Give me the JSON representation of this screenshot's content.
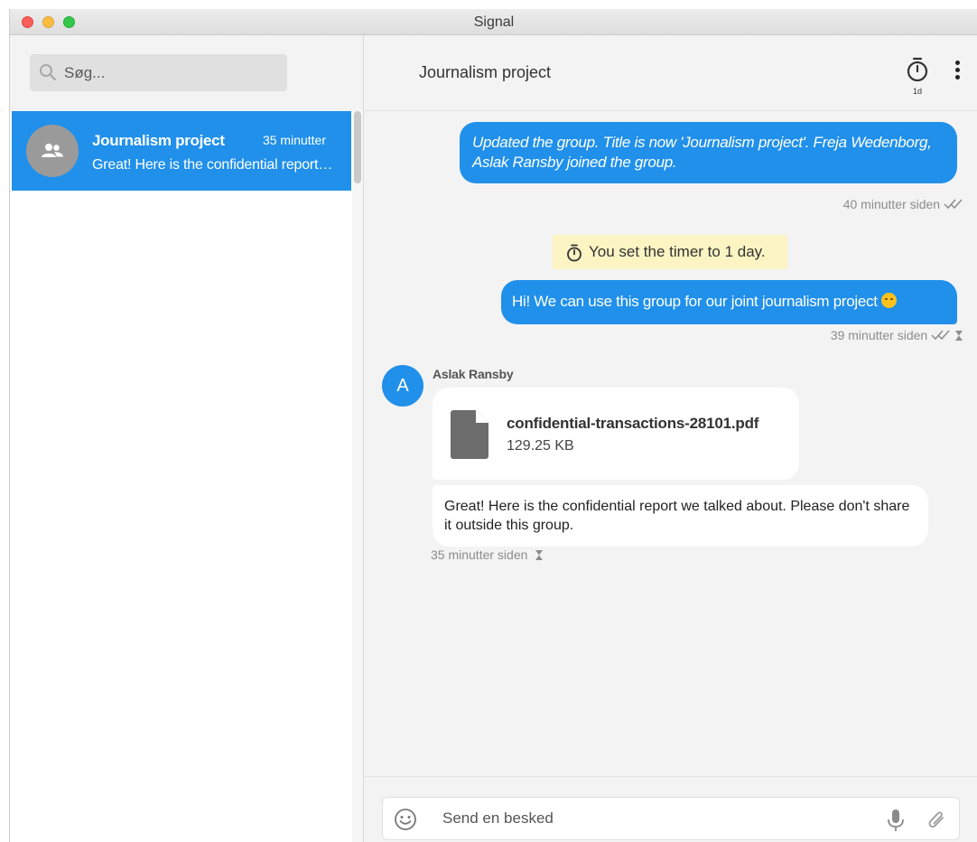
{
  "window": {
    "title": "Signal"
  },
  "sidebar": {
    "search": {
      "placeholder": "Søg..."
    },
    "conversations": [
      {
        "name": "Journalism project",
        "time": "35 minutter",
        "snippet": "Great! Here is the confidential report we talked about. Please don't share it outside this group.",
        "selected": true
      }
    ]
  },
  "conversation": {
    "title": "Journalism project",
    "timer_label": "1d",
    "messages": [
      {
        "type": "outgoing",
        "text": "Updated the group. Title is now 'Journalism project'. Freja Wedenborg, Aslak Ransby joined the group.",
        "meta": "40 minutter siden"
      },
      {
        "type": "notice",
        "text": "You set the timer to 1 day."
      },
      {
        "type": "outgoing",
        "text": "Hi! We can use this group for our joint journalism project",
        "meta": "39 minutter siden"
      },
      {
        "type": "incoming",
        "sender": "Aslak Ransby",
        "avatar_letter": "A",
        "attachment": {
          "name": "confidential-transactions-28101.pdf",
          "size": "129.25 KB"
        },
        "text": "Great! Here is the confidential report we talked about. Please don't share it outside this group.",
        "meta": "35 minutter siden"
      }
    ]
  },
  "composer": {
    "placeholder": "Send en besked"
  },
  "colors": {
    "accent": "#2090ea",
    "notice_bg": "#fcf4c3",
    "avatar_gray": "#9a9a9a"
  }
}
